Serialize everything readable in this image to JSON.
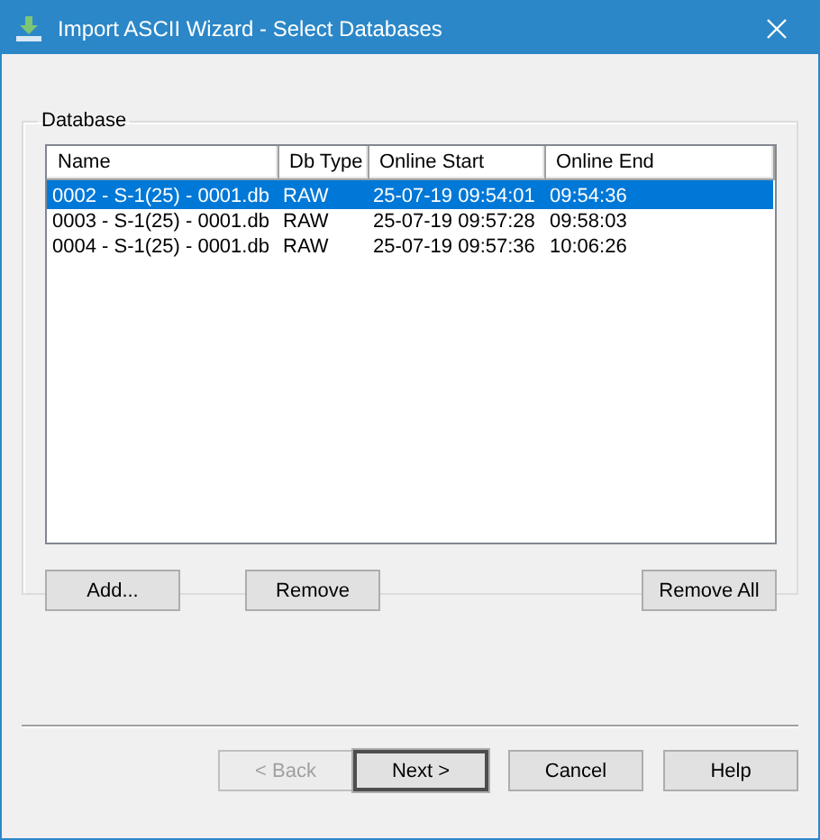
{
  "window": {
    "title": "Import ASCII Wizard - Select Databases"
  },
  "group": {
    "label": "Database"
  },
  "table": {
    "columns": [
      "Name",
      "Db Type",
      "Online Start",
      "Online End"
    ],
    "rows": [
      {
        "cells": [
          "0002 - S-1(25) - 0001.db",
          "RAW",
          "25-07-19 09:54:01",
          "09:54:36"
        ],
        "selected": true
      },
      {
        "cells": [
          "0003 - S-1(25) - 0001.db",
          "RAW",
          "25-07-19 09:57:28",
          "09:58:03"
        ],
        "selected": false
      },
      {
        "cells": [
          "0004 - S-1(25) - 0001.db",
          "RAW",
          "25-07-19 09:57:36",
          "10:06:26"
        ],
        "selected": false
      }
    ]
  },
  "list_buttons": [
    {
      "label": "Add...",
      "disabled": false,
      "default": false
    },
    {
      "label": "Remove",
      "disabled": false,
      "default": false
    },
    {
      "label": "Remove All",
      "disabled": false,
      "default": false
    }
  ],
  "footer_buttons": [
    {
      "label": "< Back",
      "disabled": true,
      "default": false
    },
    {
      "label": "Next >",
      "disabled": false,
      "default": true
    },
    {
      "label": "Cancel",
      "disabled": false,
      "default": false
    },
    {
      "label": "Help",
      "disabled": false,
      "default": false
    }
  ]
}
